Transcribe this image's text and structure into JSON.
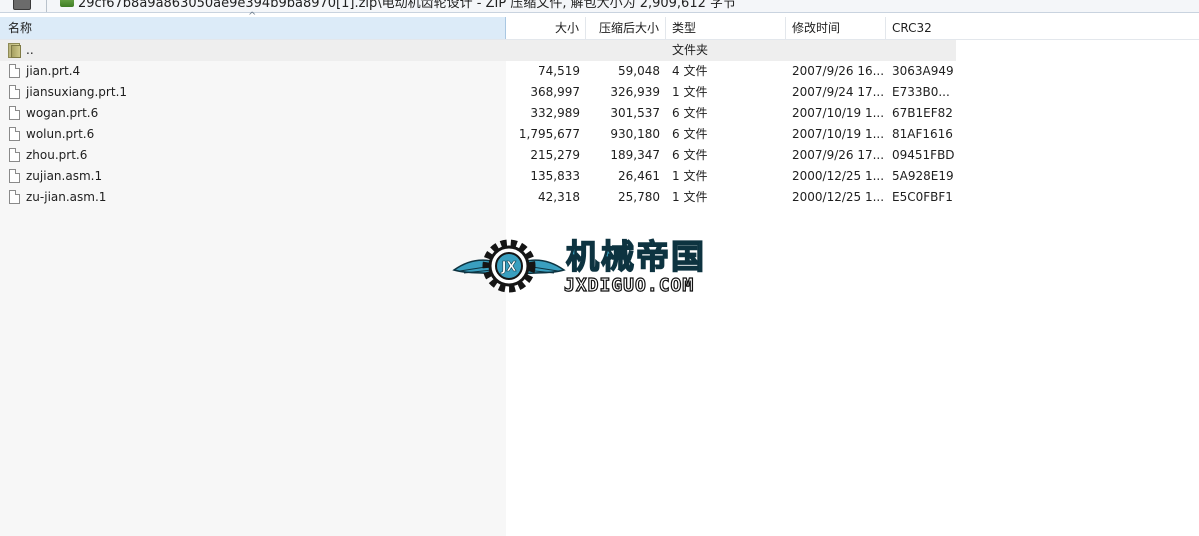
{
  "pathbar": {
    "path_text": "29cf67b8a9a863050ae9e394b9ba8970[1].zip\\电动机齿轮设计 - ZIP 压缩文件, 解包大小为 2,909,612 字节"
  },
  "columns": {
    "name": "名称",
    "size": "大小",
    "packed": "压缩后大小",
    "type": "类型",
    "modified": "修改时间",
    "crc": "CRC32",
    "sort_indicator": "^"
  },
  "parent_row": {
    "name": "..",
    "type": "文件夹"
  },
  "files": [
    {
      "name": "jian.prt.4",
      "size": "74,519",
      "packed": "59,048",
      "type": "4 文件",
      "modified": "2007/9/26 16...",
      "crc": "3063A949"
    },
    {
      "name": "jiansuxiang.prt.1",
      "size": "368,997",
      "packed": "326,939",
      "type": "1 文件",
      "modified": "2007/9/24 17...",
      "crc": "E733B0..."
    },
    {
      "name": "wogan.prt.6",
      "size": "332,989",
      "packed": "301,537",
      "type": "6 文件",
      "modified": "2007/10/19 1...",
      "crc": "67B1EF82"
    },
    {
      "name": "wolun.prt.6",
      "size": "1,795,677",
      "packed": "930,180",
      "type": "6 文件",
      "modified": "2007/10/19 1...",
      "crc": "81AF1616"
    },
    {
      "name": "zhou.prt.6",
      "size": "215,279",
      "packed": "189,347",
      "type": "6 文件",
      "modified": "2007/9/26 17...",
      "crc": "09451FBD"
    },
    {
      "name": "zujian.asm.1",
      "size": "135,833",
      "packed": "26,461",
      "type": "1 文件",
      "modified": "2000/12/25 1...",
      "crc": "5A928E19"
    },
    {
      "name": "zu-jian.asm.1",
      "size": "42,318",
      "packed": "25,780",
      "type": "1 文件",
      "modified": "2000/12/25 1...",
      "crc": "E5C0FBF1"
    }
  ],
  "watermark": {
    "title": "机械帝国",
    "subtitle": "JXDIGUO.COM",
    "emblem_letters": "JX",
    "colors": {
      "primary": "#3a9fbf",
      "outline": "#0d3340"
    }
  }
}
